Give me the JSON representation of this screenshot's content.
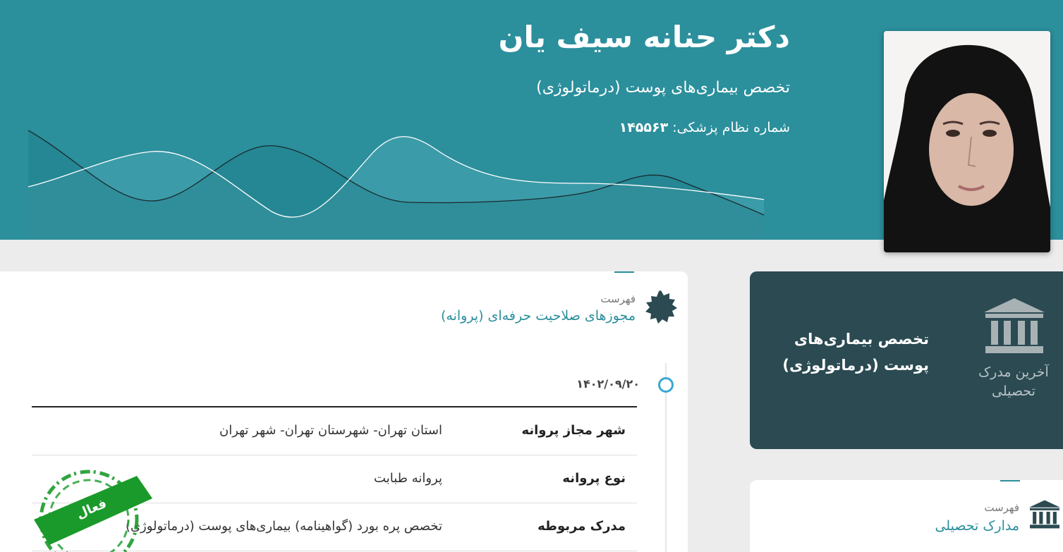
{
  "header": {
    "doctor_name": "دکتر حنانه سیف یان",
    "specialty": "تخصص بیماری‌های پوست (درماتولوژی)",
    "medical_code_label": "شماره نظام پزشکی:",
    "medical_code": "۱۴۵۵۶۳"
  },
  "license_section": {
    "subtitle": "فهرست",
    "title": "مجوزهای صلاحیت حرفه‌ای (پروانه)",
    "date": "۱۴۰۲/۰۹/۲۰",
    "rows": [
      {
        "label": "شهر مجاز پروانه",
        "value": "استان تهران- شهرستان تهران- شهر تهران"
      },
      {
        "label": "نوع پروانه",
        "value": "پروانه طبابت"
      },
      {
        "label": "مدرک مربوطه",
        "value": "تخصص پره بورد (گواهینامه) بیماری‌های پوست (درماتولوژی)"
      }
    ],
    "stamp_text": "فعال"
  },
  "degree_card": {
    "side_label": "آخرین مدرک تحصیلی",
    "title": "تخصص بیماری‌های پوست (درماتولوژی)"
  },
  "education_section": {
    "subtitle": "فهرست",
    "title": "مدارک تحصیلی"
  },
  "colors": {
    "header_bg": "#2b8f9c",
    "accent": "#2b8f9c",
    "degree_card_bg": "#2b4a52",
    "stamp_green": "#1a9a2a"
  }
}
